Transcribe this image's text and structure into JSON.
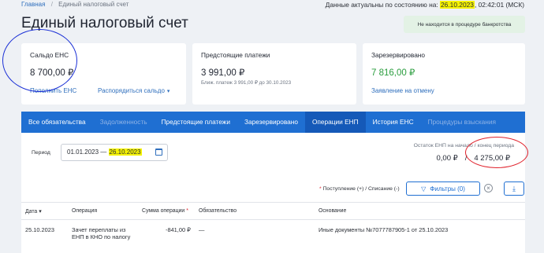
{
  "breadcrumbs": {
    "home": "Главная",
    "separator": "/",
    "current": "Единый налоговый счет"
  },
  "actuality": {
    "prefix": "Данные актуальны по состоянию на:",
    "date": "26.10.2023",
    "time": ", 02:42:01 (МСК)"
  },
  "page_title": "Единый налоговый счет",
  "bankruptcy_status": "Не находится в процедуре банкротства",
  "cards": {
    "saldo": {
      "label": "Сальдо ЕНС",
      "amount": "8 700,00 ₽",
      "link_topup": "Пополнить ЕНС",
      "link_dispose": "Распорядиться сальдо",
      "chevron": "▾"
    },
    "upcoming": {
      "label": "Предстоящие платежи",
      "amount": "3 991,00 ₽",
      "note": "Ближ. платеж 3 991,00 ₽ до 30.10.2023"
    },
    "reserved": {
      "label": "Зарезервировано",
      "amount": "7 816,00 ₽",
      "link_cancel": "Заявление на отмену",
      "amount_color": "#2a9d3e"
    }
  },
  "tabs": [
    {
      "label": "Все обязательства",
      "state": "normal"
    },
    {
      "label": "Задолженность",
      "state": "muted"
    },
    {
      "label": "Предстоящие платежи",
      "state": "normal"
    },
    {
      "label": "Зарезервировано",
      "state": "normal"
    },
    {
      "label": "Операции ЕНП",
      "state": "active"
    },
    {
      "label": "История ЕНС",
      "state": "normal"
    },
    {
      "label": "Процедуры взыскания",
      "state": "muted"
    }
  ],
  "period": {
    "label": "Период",
    "from": "01.01.2023",
    "dash": "—",
    "to": "26.10.2023"
  },
  "balance": {
    "label": "Остаток ЕНП на начало / конец периода",
    "start": "0,00 ₽",
    "slash": "/",
    "end": "4 275,00 ₽"
  },
  "legend": {
    "star": "*",
    "text": " Поступление (+) / Списание (-)"
  },
  "filters": {
    "icon": "▽",
    "label": "Фильтры (0)",
    "clear": "×",
    "download": "⤓"
  },
  "table": {
    "headers": {
      "date": "Дата",
      "sort": "▾",
      "operation": "Операция",
      "amount": "Сумма операции",
      "amount_star": " *",
      "obligation": "Обязательство",
      "basis": "Основание"
    },
    "rows": [
      {
        "date": "25.10.2023",
        "operation": "Зачет переплаты из ЕНП в КНО по налогу",
        "amount": "-841,00 ₽",
        "obligation": "—",
        "basis": "Иные документы №7077787905-1 от 25.10.2023"
      }
    ]
  },
  "colors": {
    "accent": "#1f6fd2",
    "active_tab": "#1559b8",
    "highlight": "#f5f200",
    "annotation_blue": "#1a2fd6",
    "annotation_red": "#e0202a"
  }
}
